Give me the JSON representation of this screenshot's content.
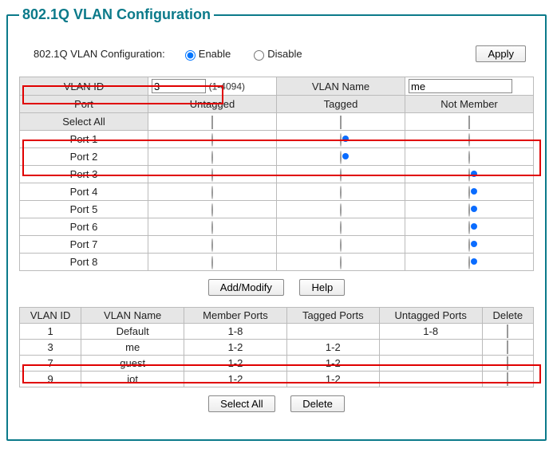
{
  "title": "802.1Q VLAN Configuration",
  "top": {
    "label": "802.1Q VLAN Configuration:",
    "enable": "Enable",
    "disable": "Disable",
    "mode_selected": "enable",
    "apply": "Apply"
  },
  "cfg": {
    "vlan_id_hdr": "VLAN ID",
    "vlan_id_value": "3",
    "vlan_id_hint": "(1-4094)",
    "vlan_name_hdr": "VLAN Name",
    "vlan_name_value": "me",
    "port_hdr": "Port",
    "untagged_hdr": "Untagged",
    "tagged_hdr": "Tagged",
    "notmember_hdr": "Not Member",
    "select_all": "Select All",
    "ports": [
      {
        "name": "Port 1",
        "sel": "tagged"
      },
      {
        "name": "Port 2",
        "sel": "tagged"
      },
      {
        "name": "Port 3",
        "sel": "notmember"
      },
      {
        "name": "Port 4",
        "sel": "notmember"
      },
      {
        "name": "Port 5",
        "sel": "notmember"
      },
      {
        "name": "Port 6",
        "sel": "notmember"
      },
      {
        "name": "Port 7",
        "sel": "notmember"
      },
      {
        "name": "Port 8",
        "sel": "notmember"
      }
    ]
  },
  "buttons": {
    "add_modify": "Add/Modify",
    "help": "Help",
    "select_all": "Select All",
    "delete": "Delete"
  },
  "list": {
    "headers": {
      "vlan_id": "VLAN ID",
      "vlan_name": "VLAN Name",
      "member": "Member Ports",
      "tagged": "Tagged Ports",
      "untagged": "Untagged Ports",
      "delete": "Delete"
    },
    "rows": [
      {
        "id": "1",
        "name": "Default",
        "member": "1-8",
        "tagged": "",
        "untagged": "1-8"
      },
      {
        "id": "3",
        "name": "me",
        "member": "1-2",
        "tagged": "1-2",
        "untagged": ""
      },
      {
        "id": "7",
        "name": "guest",
        "member": "1-2",
        "tagged": "1-2",
        "untagged": ""
      },
      {
        "id": "9",
        "name": "iot",
        "member": "1-2",
        "tagged": "1-2",
        "untagged": ""
      }
    ]
  }
}
